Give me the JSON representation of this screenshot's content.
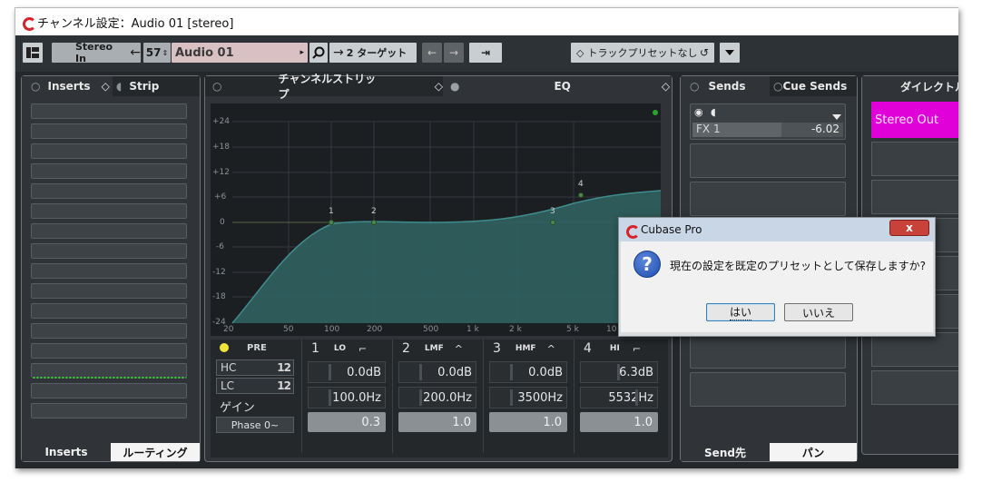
{
  "window": {
    "title": "チャンネル設定：Audio 01 [stereo]"
  },
  "toolbar": {
    "input_label": "Stereo In",
    "channel_number": "57",
    "channel_name": "Audio 01",
    "target_label": "2 ターゲット",
    "preset_label": "トラックプリセットなし"
  },
  "inserts_panel": {
    "tab_inserts": "Inserts",
    "tab_strip": "Strip",
    "bottom_tab_inserts": "Inserts",
    "bottom_tab_routing": "ルーティング"
  },
  "channel_strip_panel": {
    "tab_label": "チャンネルストリップ"
  },
  "eq_panel": {
    "tab_label": "EQ",
    "db_labels": [
      "+24",
      "+18",
      "+12",
      "+6",
      "0",
      "-6",
      "-12",
      "-18",
      "-24"
    ],
    "freq_labels": [
      "20",
      "50",
      "100",
      "200",
      "500",
      "1 k",
      "2 k",
      "5 k",
      "10"
    ],
    "pre_label": "PRE",
    "hc_label": "HC",
    "lc_label": "LC",
    "gain_label": "ゲイン",
    "phase_label": "Phase 0~",
    "slope_hc": "12",
    "slope_lc": "12",
    "bands": [
      {
        "num": "1",
        "name": "LO",
        "gain": "0.0dB",
        "freq": "100.0Hz",
        "q": "0.3"
      },
      {
        "num": "2",
        "name": "LMF",
        "gain": "0.0dB",
        "freq": "200.0Hz",
        "q": "1.0"
      },
      {
        "num": "3",
        "name": "HMF",
        "gain": "0.0dB",
        "freq": "3500Hz",
        "q": "1.0"
      },
      {
        "num": "4",
        "name": "HI",
        "gain": "6.3dB",
        "freq": "5532Hz",
        "q": "1.0"
      }
    ],
    "curve_color": "#2f5e5e",
    "accent_color": "#f1e23b"
  },
  "sends_panel": {
    "tab_sends": "Sends",
    "tab_cue_sends": "Cue Sends",
    "send1_name": "FX 1",
    "send1_value": "-6.02",
    "bottom_tab_send_dest": "Send先",
    "bottom_tab_pan": "パン"
  },
  "direct_panel": {
    "tab_label": "ダイレクトルーティング",
    "output_label": "Stereo Out",
    "output_color": "#e000d8"
  },
  "dialog": {
    "title": "Cubase Pro",
    "message": "現在の設定を既定のプリセットとして保存しますか?",
    "yes_label": "はい",
    "no_label": "いいえ",
    "close_label": "x"
  }
}
